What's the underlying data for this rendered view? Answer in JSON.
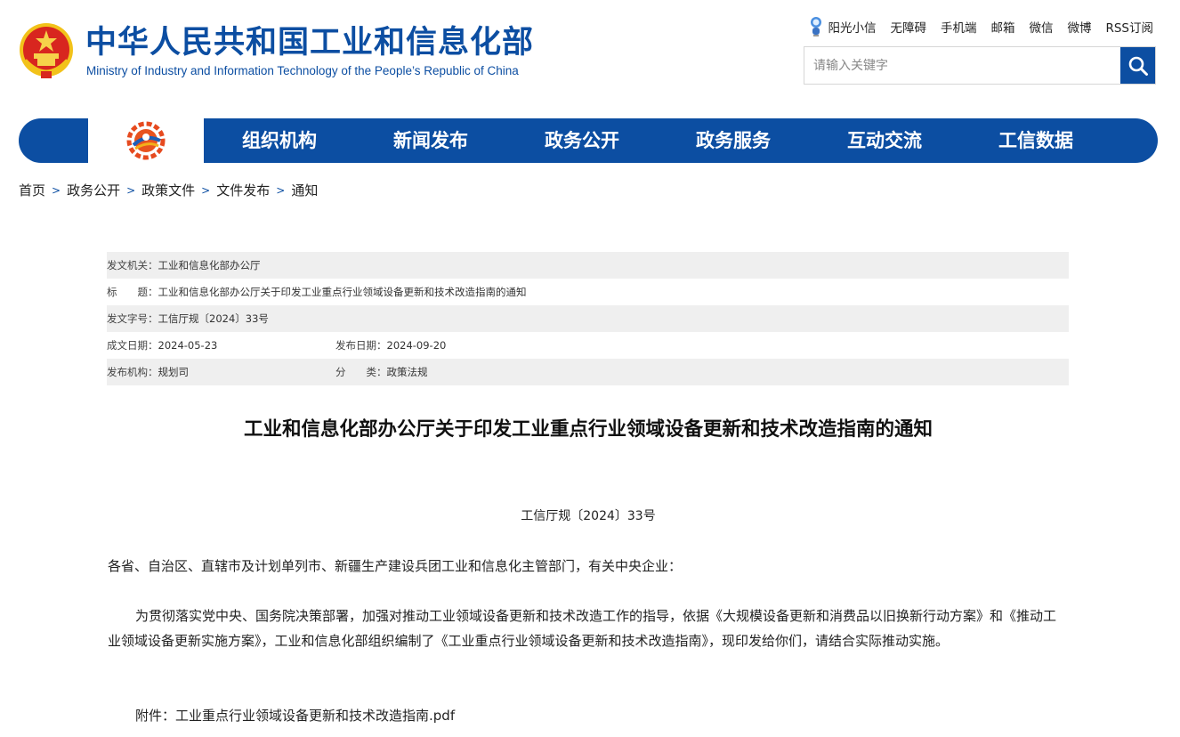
{
  "header": {
    "title": "中华人民共和国工业和信息化部",
    "subtitle": "Ministry of Industry and Information Technology of the People’s Republic of China",
    "top_links": [
      "阳光小信",
      "无障碍",
      "手机端",
      "邮箱",
      "微信",
      "微博",
      "RSS订阅"
    ],
    "search_placeholder": "请输入关键字"
  },
  "nav": {
    "items": [
      "组织机构",
      "新闻发布",
      "政务公开",
      "政务服务",
      "互动交流",
      "工信数据"
    ]
  },
  "breadcrumb": [
    "首页",
    "政务公开",
    "政策文件",
    "文件发布",
    "通知"
  ],
  "meta": {
    "issuer_label": "发文机关：",
    "issuer": "工业和信息化部办公厅",
    "title_label": "标　　题：",
    "title": "工业和信息化部办公厅关于印发工业重点行业领域设备更新和技术改造指南的通知",
    "docno_label": "发文字号：",
    "docno": "工信厅规〔2024〕33号",
    "created_label": "成文日期：",
    "created": "2024-05-23",
    "published_label": "发布日期：",
    "published": "2024-09-20",
    "org_label": "发布机构：",
    "org": "规划司",
    "category_label": "分　　类：",
    "category": "政策法规"
  },
  "article": {
    "title": "工业和信息化部办公厅关于印发工业重点行业领域设备更新和技术改造指南的通知",
    "doc_number": "工信厅规〔2024〕33号",
    "salutation": "各省、自治区、直辖市及计划单列市、新疆生产建设兵团工业和信息化主管部门，有关中央企业：",
    "body": "为贯彻落实党中央、国务院决策部署，加强对推动工业领域设备更新和技术改造工作的指导，依据《大规模设备更新和消费品以旧换新行动方案》和《推动工业领域设备更新实施方案》，工业和信息化部组织编制了《工业重点行业领域设备更新和技术改造指南》，现印发给你们，请结合实际推动实施。",
    "attachment_label": "附件：",
    "attachment_file": "工业重点行业领域设备更新和技术改造指南.pdf"
  },
  "colors": {
    "brand_blue": "#0c4ea2",
    "meta_row_gray": "#efefef"
  },
  "icons": [
    "national-emblem-icon",
    "robot-icon",
    "search-icon",
    "home-logo-icon",
    "chevron-right-icon"
  ]
}
